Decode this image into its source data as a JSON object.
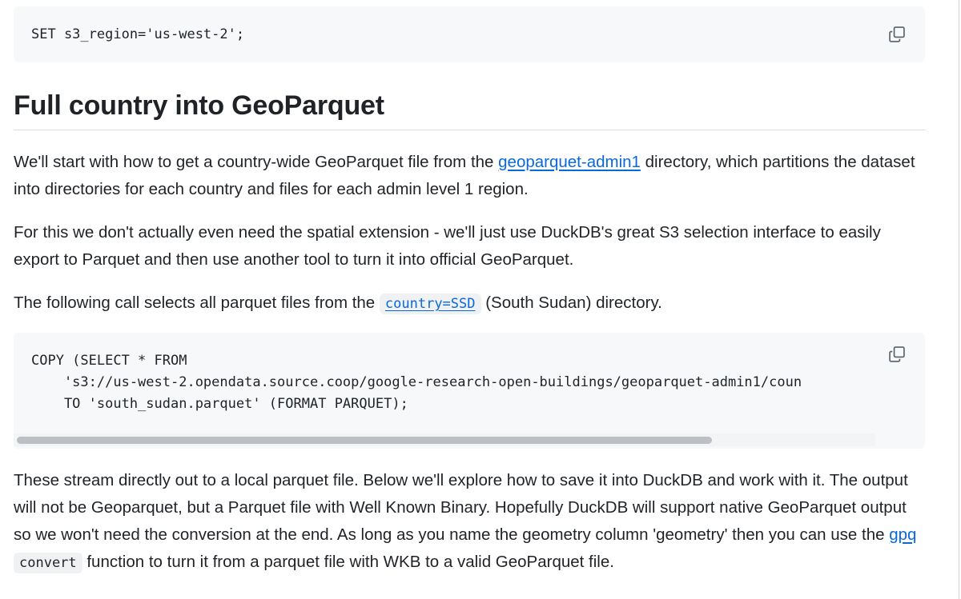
{
  "colors": {
    "link": "#0969da",
    "text": "#1f2328",
    "code_bg": "#f6f8fa"
  },
  "code_block_1": {
    "code": "SET s3_region='us-west-2';",
    "copy_icon": "copy-icon"
  },
  "heading": "Full country into GeoParquet",
  "para1": {
    "before": "We'll start with how to get a country-wide GeoParquet file from the ",
    "link": "geoparquet-admin1",
    "after": " directory, which partitions the dataset into directories for each country and files for each admin level 1 region."
  },
  "para2": {
    "text": "For this we don't actually even need the spatial extension - we'll just use DuckDB's great S3 selection interface to easily export to Parquet and then use another tool to turn it into official GeoParquet."
  },
  "para3": {
    "before": "The following call selects all parquet files from the ",
    "code_link": "country=SSD",
    "after": " (South Sudan) directory."
  },
  "code_block_2": {
    "line1": "COPY (SELECT * FROM",
    "line2": "    's3://us-west-2.opendata.source.coop/google-research-open-buildings/geoparquet-admin1/coun",
    "line3": "    TO 'south_sudan.parquet' (FORMAT PARQUET);",
    "copy_icon": "copy-icon"
  },
  "para4": {
    "before": "These stream directly out to a local parquet file. Below we'll explore how to save it into DuckDB and work with it. The output will not be Geoparquet, but a Parquet file with Well Known Binary. Hopefully DuckDB will support native GeoParquet output so we won't need the conversion at the end. As long as you name the geometry column 'geometry' then you can use the ",
    "link": "gpq",
    "code": "convert",
    "after": " function to turn it from a parquet file with WKB to a valid GeoParquet file."
  }
}
